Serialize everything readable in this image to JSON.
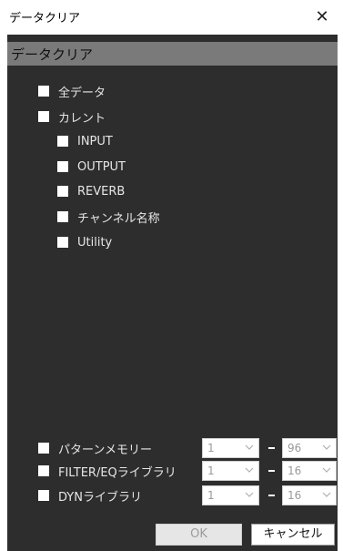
{
  "window": {
    "title": "データクリア",
    "close_symbol": "✕"
  },
  "section": {
    "title": "データクリア"
  },
  "options": {
    "all_data": "全データ",
    "current": "カレント",
    "current_items": [
      "INPUT",
      "OUTPUT",
      "REVERB",
      "チャンネル名称",
      "Utility"
    ]
  },
  "libraries": [
    {
      "label": "パターンメモリー",
      "from": "1",
      "to": "96"
    },
    {
      "label": "FILTER/EQライブラリ",
      "from": "1",
      "to": "16"
    },
    {
      "label": "DYNライブラリ",
      "from": "1",
      "to": "16"
    }
  ],
  "buttons": {
    "ok": "OK",
    "cancel": "キャンセル"
  }
}
